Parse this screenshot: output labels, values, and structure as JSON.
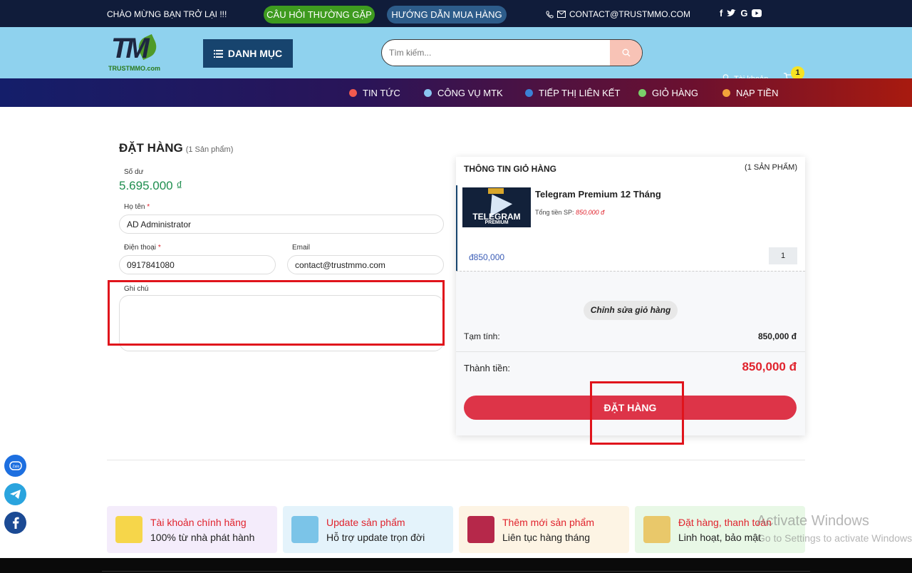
{
  "topbar": {
    "welcome": "CHÀO MỪNG BẠN TRỞ LẠI !!!",
    "faq": "CÂU HỎI THƯỜNG GẶP",
    "guide": "HƯỚNG DẪN MUA HÀNG",
    "contact": "CONTACT@TRUSTMMO.COM",
    "social": [
      "facebook-icon",
      "twitter-icon",
      "google-icon",
      "youtube-icon"
    ]
  },
  "header": {
    "logo_letters": "TM",
    "logo_brand": "TRUSTMMO.com",
    "menu_label": "DANH MỤC",
    "search_placeholder": "Tìm kiếm...",
    "account_label": "Tài khoản",
    "cart_count": "1"
  },
  "nav": [
    {
      "label": "TIN TỨC",
      "icon_color": "#f25a4e"
    },
    {
      "label": "CÔNG VỤ MTK",
      "icon_color": "#8ac6f0"
    },
    {
      "label": "TIẾP THỊ LIÊN KẾT",
      "icon_color": "#3b82d6"
    },
    {
      "label": "GIỎ HÀNG",
      "icon_color": "#7ad06a"
    },
    {
      "label": "NẠP TIỀN",
      "icon_color": "#f2a23a"
    }
  ],
  "order": {
    "title": "ĐẶT HÀNG",
    "count": "(1 Sản phẩm)",
    "balance_label": "Số dư",
    "balance": "5.695.000 ₫",
    "name_label": "Họ tên",
    "name_value": "AD Administrator",
    "phone_label": "Điện thoại",
    "phone_value": "0917841080",
    "email_label": "Email",
    "email_value": "contact@trustmmo.com",
    "note_label": "Ghi chú",
    "note_value": ""
  },
  "cart": {
    "title": "THÔNG TIN GIỎ HÀNG",
    "count": "(1 SẢN PHẨM)",
    "product_image_text": "TELEGRAM",
    "product_image_subtext": "PREMIUM",
    "product_name": "Telegram Premium 12 Tháng",
    "total_label": "Tổng tiền SP:",
    "total_value": "850,000 đ",
    "price": "đ850,000",
    "qty": "1",
    "edit": "Chỉnh sửa giỏ hàng",
    "subtotal_label": "Tạm tính:",
    "subtotal_value": "850,000 đ",
    "grand_label": "Thành tiền:",
    "grand_value": "850,000 đ",
    "order_button": "ĐẶT HÀNG"
  },
  "floating": [
    "zalo-icon",
    "telegram-icon",
    "facebook-icon"
  ],
  "features": [
    {
      "title": "Tài khoản chính hãng",
      "sub": "100% từ nhà phát hành",
      "bg": "#f4ecfb"
    },
    {
      "title": "Update sản phẩm",
      "sub": "Hỗ trợ update trọn đời",
      "bg": "#e4f3fb"
    },
    {
      "title": "Thêm mới sản phẩm",
      "sub": "Liên tục hàng tháng",
      "bg": "#fdf4e4"
    },
    {
      "title": "Đặt hàng, thanh toán",
      "sub": "Linh hoạt, bảo mật",
      "bg": "#e8f8e6"
    }
  ],
  "watermark": {
    "line1": "Activate Windows",
    "line2": "Go to Settings to activate Windows."
  },
  "colors": {
    "accent_red": "#dd3448",
    "navy": "#17446e",
    "green": "#1f8e4f"
  }
}
